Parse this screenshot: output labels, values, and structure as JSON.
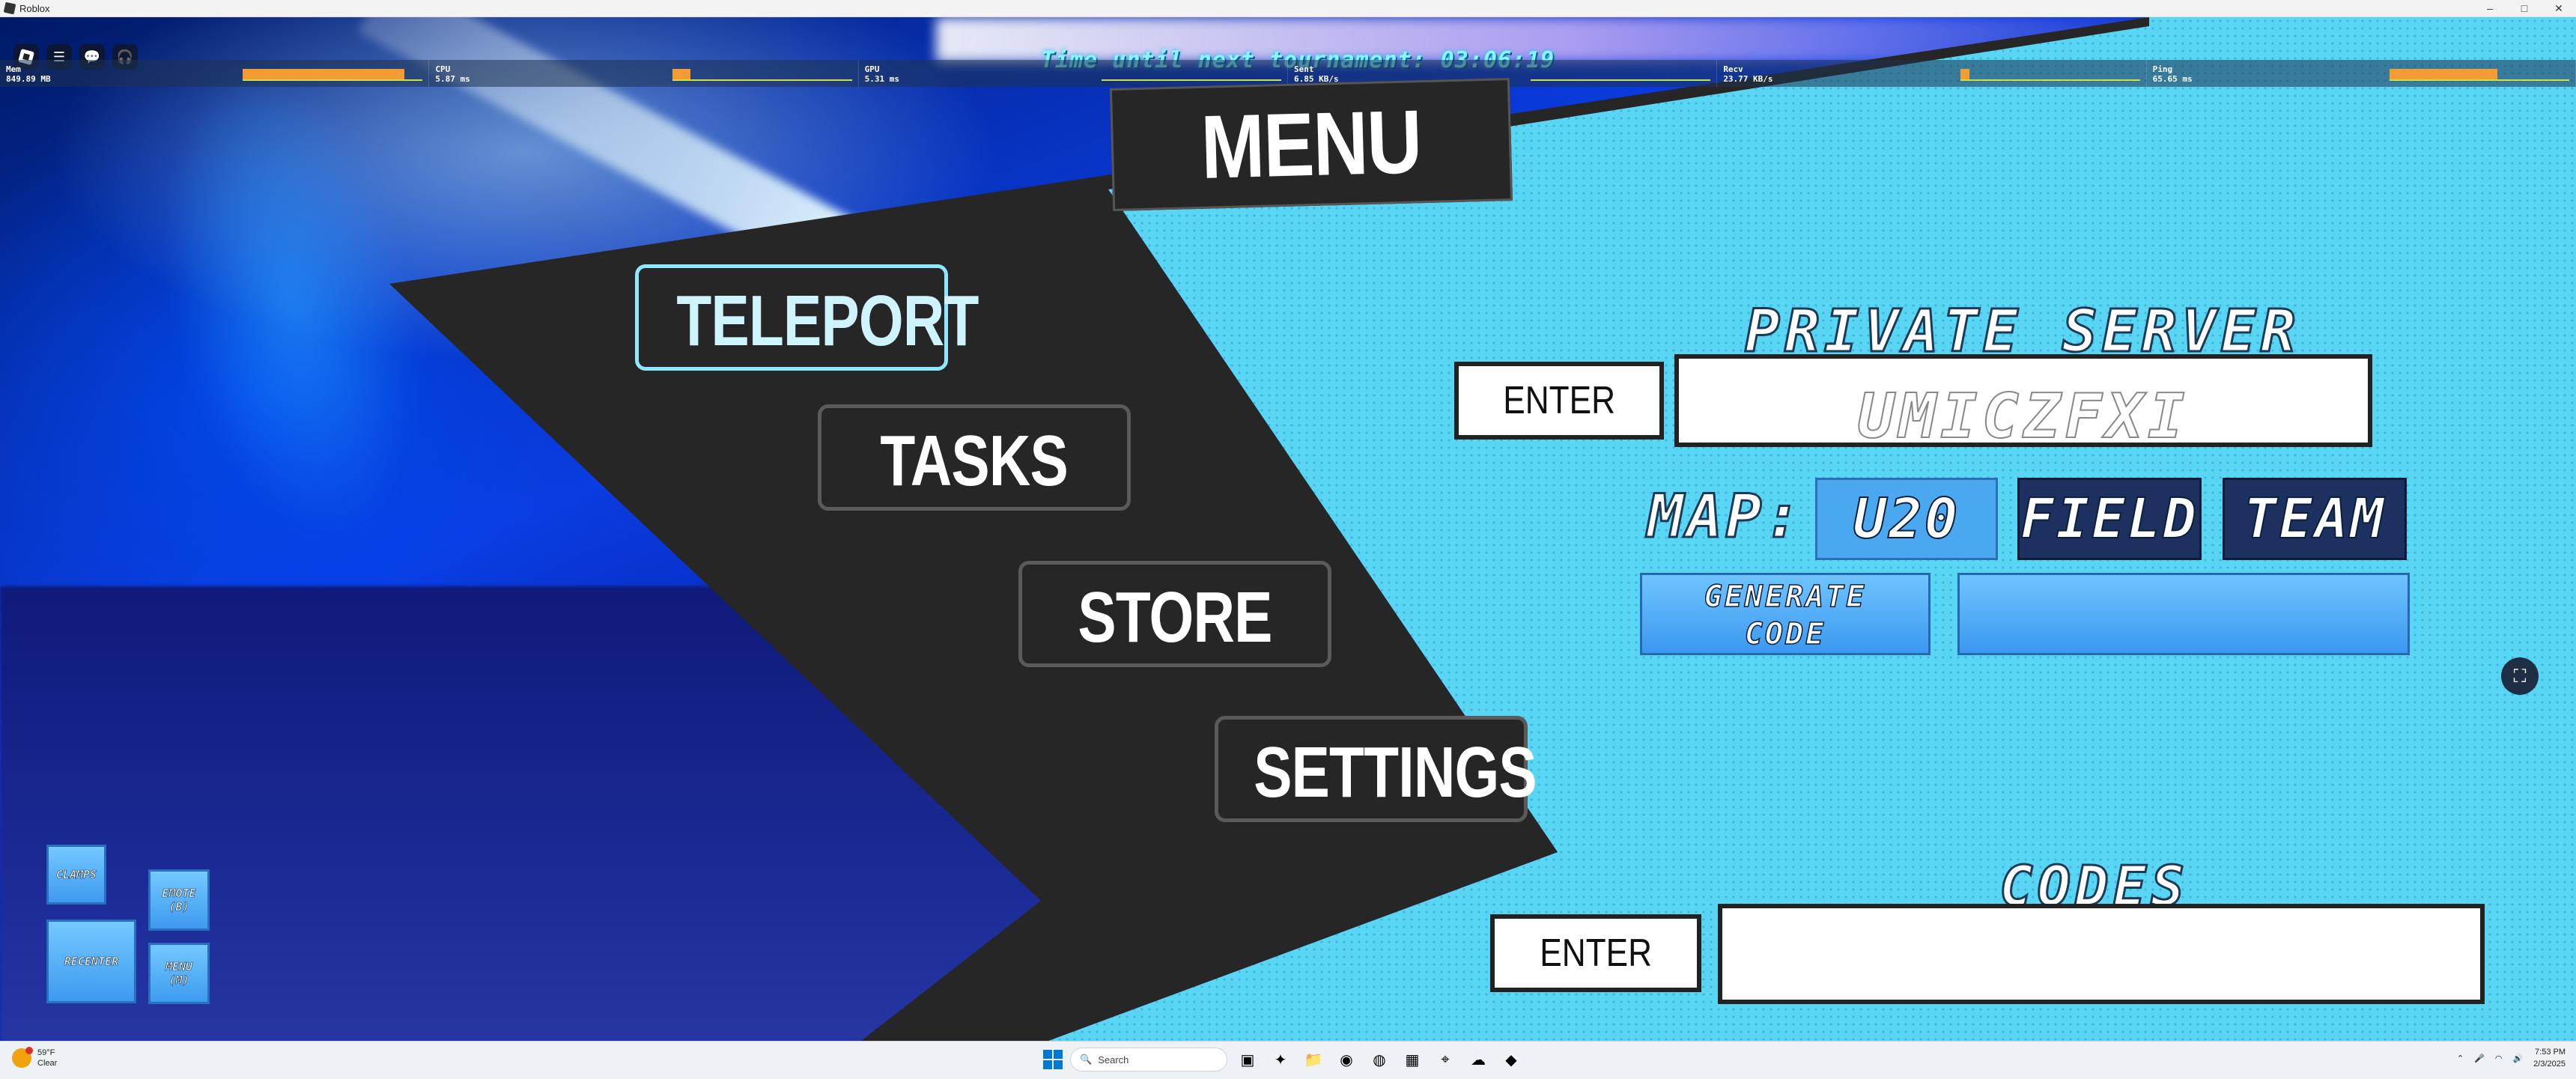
{
  "window": {
    "title": "Roblox",
    "controls": [
      "–",
      "□",
      "✕"
    ]
  },
  "topbar": {
    "icons": [
      "roblox-logo-icon",
      "hamburger-menu-icon",
      "chat-icon",
      "headset-icon"
    ],
    "tournament_text": "Time until next tournament: 03:06:19"
  },
  "stats": [
    {
      "label": "Mem",
      "value": "849.89 MB",
      "fill": 0.9
    },
    {
      "label": "CPU",
      "value": "5.87 ms",
      "fill": 0.1
    },
    {
      "label": "GPU",
      "value": "5.31 ms",
      "fill": 0.0
    },
    {
      "label": "Sent",
      "value": "6.85 KB/s",
      "fill": 0.0
    },
    {
      "label": "Recv",
      "value": "23.77 KB/s",
      "fill": 0.05
    },
    {
      "label": "Ping",
      "value": "65.65 ms",
      "fill": 0.6
    }
  ],
  "menu": {
    "title": "MENU",
    "buttons": [
      "TELEPORT",
      "TASKS",
      "STORE",
      "SETTINGS"
    ]
  },
  "private_server": {
    "title": "PRIVATE SERVER",
    "enter_label": "ENTER",
    "code_placeholder": "UMICZFXI",
    "map_label": "MAP:",
    "map_options": [
      "U20",
      "FIELD",
      "TEAM"
    ],
    "generate_label_1": "GENERATE",
    "generate_label_2": "CODE",
    "generated_code": ""
  },
  "codes": {
    "title": "CODES",
    "enter_label": "ENTER",
    "input_value": ""
  },
  "mini_buttons": {
    "clamps": "CLAMPS",
    "emote_1": "EMOTE",
    "emote_2": "(B)",
    "recenter": "RECENTER",
    "menu_1": "MENU",
    "menu_2": "(M)"
  },
  "taskbar": {
    "weather_temp": "59°F",
    "weather_desc": "Clear",
    "search_placeholder": "Search",
    "time": "7:53 PM",
    "date": "2/3/2025"
  },
  "colors": {
    "panel_cyan": "#5ad6f5",
    "dark": "#262626",
    "button_blue": "#4aa8f0",
    "button_navy": "#1c3160",
    "tournament_text": "#8ef2ff"
  }
}
